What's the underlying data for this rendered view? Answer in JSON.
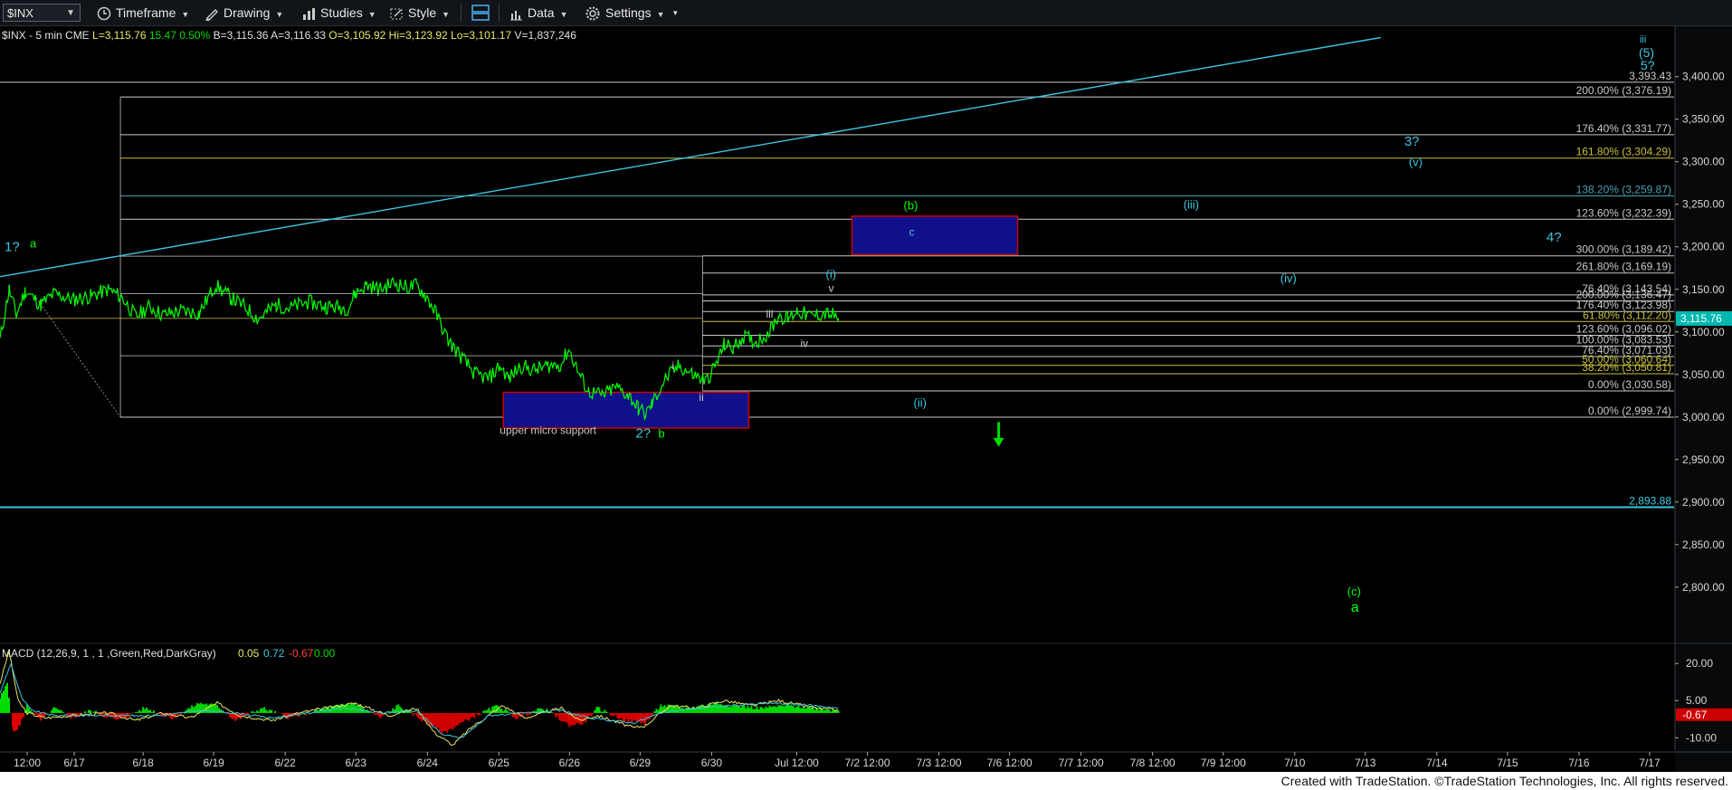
{
  "toolbar": {
    "symbol": "$INX",
    "items": [
      "Timeframe",
      "Drawing",
      "Studies",
      "Style",
      "Data",
      "Settings"
    ]
  },
  "colors": {
    "background": "#000000",
    "price": "#00ff00",
    "wave_cyan": "#3ec6e0",
    "fib_lines": "#c9c9c9",
    "box_fill": "#10108a",
    "box_border": "#cc0000",
    "macd_pos": "#00dd00",
    "macd_neg": "#dd0000",
    "last_price_tag": "#00b8b0"
  },
  "chart_data": {
    "type": "line",
    "header": {
      "symbol": "$INX - 5 min",
      "exchange": "CME",
      "last": "L=3,115.76",
      "change": "15.47",
      "pct": "0.50%",
      "bid": "B=3,115.36",
      "ask": "A=3,116.33",
      "open": "O=3,105.92",
      "high": "Hi=3,123.92",
      "low": "Lo=3,101.17",
      "volume": "V=1,837,246"
    },
    "x_labels": [
      "12:00",
      "6/17",
      "6/18",
      "6/19",
      "6/22",
      "6/23",
      "6/24",
      "6/25",
      "6/26",
      "6/29",
      "6/30",
      "Jul 12:00",
      "7/2 12:00",
      "7/3 12:00",
      "7/6 12:00",
      "7/7 12:00",
      "7/8 12:00",
      "7/9 12:00",
      "7/10",
      "7/13",
      "7/14",
      "7/15",
      "7/16",
      "7/17"
    ],
    "x_label_slots": [
      30,
      82,
      158,
      236,
      315,
      393,
      472,
      551,
      629,
      707,
      786,
      880,
      958,
      1037,
      1115,
      1194,
      1273,
      1351,
      1430,
      1508,
      1587,
      1665,
      1744,
      1822
    ],
    "x_slot_range": [
      0,
      1850
    ],
    "y_ticks": [
      2800,
      2850,
      2900,
      2950,
      3000,
      3050,
      3100,
      3150,
      3200,
      3250,
      3300,
      3350,
      3400
    ],
    "y_tick_labels": [
      "2,800.00",
      "2,850.00",
      "2,900.00",
      "2,950.00",
      "3,000.00",
      "3,050.00",
      "3,100.00",
      "3,150.00",
      "3,200.00",
      "3,250.00",
      "3,300.00",
      "3,350.00",
      "3,400.00"
    ],
    "ylim": [
      2736,
      3455
    ],
    "last_price": 3115.76,
    "last_price_label": "3,115.76",
    "price_keypoints": [
      [
        0,
        3090
      ],
      [
        10,
        3150
      ],
      [
        18,
        3120
      ],
      [
        28,
        3148
      ],
      [
        45,
        3132
      ],
      [
        60,
        3145
      ],
      [
        80,
        3138
      ],
      [
        100,
        3142
      ],
      [
        120,
        3150
      ],
      [
        135,
        3140
      ],
      [
        150,
        3118
      ],
      [
        165,
        3130
      ],
      [
        180,
        3120
      ],
      [
        200,
        3125
      ],
      [
        220,
        3122
      ],
      [
        238,
        3155
      ],
      [
        255,
        3140
      ],
      [
        270,
        3130
      ],
      [
        285,
        3115
      ],
      [
        305,
        3132
      ],
      [
        320,
        3128
      ],
      [
        340,
        3135
      ],
      [
        360,
        3130
      ],
      [
        385,
        3128
      ],
      [
        392,
        3145
      ],
      [
        405,
        3155
      ],
      [
        420,
        3150
      ],
      [
        435,
        3158
      ],
      [
        450,
        3152
      ],
      [
        460,
        3155
      ],
      [
        472,
        3140
      ],
      [
        480,
        3125
      ],
      [
        495,
        3090
      ],
      [
        510,
        3070
      ],
      [
        525,
        3050
      ],
      [
        540,
        3045
      ],
      [
        552,
        3060
      ],
      [
        562,
        3045
      ],
      [
        575,
        3060
      ],
      [
        590,
        3055
      ],
      [
        605,
        3060
      ],
      [
        620,
        3062
      ],
      [
        628,
        3080
      ],
      [
        640,
        3050
      ],
      [
        650,
        3030
      ],
      [
        665,
        3025
      ],
      [
        680,
        3035
      ],
      [
        695,
        3025
      ],
      [
        705,
        3010
      ],
      [
        713,
        3003
      ],
      [
        720,
        3015
      ],
      [
        735,
        3045
      ],
      [
        750,
        3060
      ],
      [
        765,
        3050
      ],
      [
        780,
        3042
      ],
      [
        790,
        3060
      ],
      [
        800,
        3085
      ],
      [
        810,
        3080
      ],
      [
        820,
        3095
      ],
      [
        835,
        3088
      ],
      [
        850,
        3100
      ],
      [
        860,
        3120
      ],
      [
        870,
        3115
      ],
      [
        880,
        3125
      ],
      [
        895,
        3118
      ],
      [
        910,
        3122
      ],
      [
        920,
        3120
      ],
      [
        926,
        3116
      ]
    ],
    "ma_keypoints": [
      [
        0,
        3150
      ],
      [
        40,
        3100
      ]
    ],
    "horizontal_lines": [
      {
        "value": 3393.43,
        "label": "3,393.43",
        "x0": 0,
        "color": "#c9c9c9"
      },
      {
        "value": 3376.19,
        "label": "200.00% (3,376.19)",
        "x0": 133,
        "color": "#c9c9c9"
      },
      {
        "value": 3331.77,
        "label": "176.40% (3,331.77)",
        "x0": 133,
        "color": "#c9c9c9"
      },
      {
        "value": 3304.29,
        "label": "161.80% (3,304.29)",
        "x0": 133,
        "color": "#c8c040"
      },
      {
        "value": 3259.87,
        "label": "138.20% (3,259.87)",
        "x0": 133,
        "color": "#4aa0b0"
      },
      {
        "value": 3232.39,
        "label": "123.60% (3,232.39)",
        "x0": 133,
        "color": "#c9c9c9"
      },
      {
        "value": 3189.42,
        "label": "300.00% (3,189.42)",
        "x0": 776,
        "color": "#c9c9c9"
      },
      {
        "value": 3169.19,
        "label": "261.80% (3,169.19)",
        "x0": 776,
        "color": "#c9c9c9"
      },
      {
        "value": 3143.54,
        "label": "76.40% (3,143.54)",
        "x0": 776,
        "color": "#c9c9c9"
      },
      {
        "value": 3136.47,
        "label": "200.00% (3,136.47)",
        "x0": 776,
        "color": "#c9c9c9"
      },
      {
        "value": 3123.98,
        "label": "176.40% (3,123.98)",
        "x0": 776,
        "color": "#c9c9c9"
      },
      {
        "value": 3112.2,
        "label": "61.80% (3,112.20)",
        "x0": 776,
        "color": "#c8c040"
      },
      {
        "value": 3096.02,
        "label": "123.60% (3,096.02)",
        "x0": 776,
        "color": "#c9c9c9"
      },
      {
        "value": 3083.53,
        "label": "100.00% (3,083.53)",
        "x0": 776,
        "color": "#c9c9c9"
      },
      {
        "value": 3071.03,
        "label": "76.40% (3,071.03)",
        "x0": 776,
        "color": "#c9c9c9"
      },
      {
        "value": 3060.64,
        "label": "50.00% (3,060.64)",
        "x0": 776,
        "color": "#c8c040"
      },
      {
        "value": 3050.81,
        "label": "38.20% (3,050.81)",
        "x0": 776,
        "color": "#c8c040"
      },
      {
        "value": 3030.58,
        "label": "0.00% (3,030.58)",
        "x0": 776,
        "color": "#c9c9c9"
      },
      {
        "value": 2999.74,
        "label": "0.00% (2,999.74)",
        "x0": 133,
        "color": "#c9c9c9"
      },
      {
        "value": 2893.88,
        "label": "2,893.88",
        "x0": 0,
        "color": "#3ec6e0"
      },
      {
        "value": 3145,
        "label": "",
        "x0": 133,
        "x1": 776,
        "color": "#c9c9c9"
      },
      {
        "value": 3072,
        "label": "",
        "x0": 133,
        "x1": 776,
        "color": "#c9c9c9"
      },
      {
        "value": 3189,
        "label": "",
        "x0": 133,
        "x1": 776,
        "color": "#c9c9c9"
      },
      {
        "value": 3116,
        "label": "",
        "x0": 0,
        "x1": 776,
        "color": "#c8c040"
      }
    ],
    "trendline": {
      "p1": [
        0,
        3165
      ],
      "p2": [
        1525,
        3446
      ]
    },
    "zones": [
      {
        "x0": 556,
        "x1": 827,
        "y0": 3029,
        "y1": 2987,
        "label": "upper micro support",
        "label_x": 552,
        "label_y": 2980
      },
      {
        "x0": 941,
        "x1": 1124,
        "y0": 3236,
        "y1": 3191,
        "label": "c",
        "label_x": 1004,
        "label_y": 3213
      }
    ],
    "wave_labels": [
      {
        "text": "1?",
        "x": 5,
        "y": 3195,
        "color": "#3ec6e0",
        "size": 15
      },
      {
        "text": "a",
        "x": 33,
        "y": 3199,
        "color": "#00ff00",
        "size": 13
      },
      {
        "text": "2?",
        "x": 702,
        "y": 2976,
        "color": "#3ec6e0",
        "size": 15
      },
      {
        "text": "b",
        "x": 727,
        "y": 2976,
        "color": "#00ff00",
        "size": 13
      },
      {
        "text": "i",
        "x": 742,
        "y": 3056,
        "color": "#c9c9c9",
        "size": 12
      },
      {
        "text": "ii",
        "x": 772,
        "y": 3019,
        "color": "#c9c9c9",
        "size": 12
      },
      {
        "text": "iii",
        "x": 846,
        "y": 3117,
        "color": "#c9c9c9",
        "size": 12
      },
      {
        "text": "iv",
        "x": 884,
        "y": 3082,
        "color": "#c9c9c9",
        "size": 12
      },
      {
        "text": "v",
        "x": 915,
        "y": 3147,
        "color": "#c9c9c9",
        "size": 12
      },
      {
        "text": "(i)",
        "x": 912,
        "y": 3163,
        "color": "#3ec6e0",
        "size": 13
      },
      {
        "text": "(ii)",
        "x": 1009,
        "y": 3012,
        "color": "#3ec6e0",
        "size": 13
      },
      {
        "text": "(iii)",
        "x": 1307,
        "y": 3245,
        "color": "#3ec6e0",
        "size": 13
      },
      {
        "text": "(iv)",
        "x": 1414,
        "y": 3158,
        "color": "#3ec6e0",
        "size": 13
      },
      {
        "text": "(v)",
        "x": 1556,
        "y": 3295,
        "color": "#3ec6e0",
        "size": 13
      },
      {
        "text": "3?",
        "x": 1551,
        "y": 3319,
        "color": "#3ec6e0",
        "size": 15
      },
      {
        "text": "4?",
        "x": 1708,
        "y": 3206,
        "color": "#3ec6e0",
        "size": 15
      },
      {
        "text": "(b)",
        "x": 998,
        "y": 3244,
        "color": "#00ff00",
        "size": 13
      },
      {
        "text": "(c)",
        "x": 1488,
        "y": 2790,
        "color": "#00ff00",
        "size": 13
      },
      {
        "text": "a",
        "x": 1492,
        "y": 2771,
        "color": "#00ff00",
        "size": 16
      },
      {
        "text": "(5)",
        "x": 1810,
        "y": 3423,
        "color": "#3ec6e0",
        "size": 14
      },
      {
        "text": "5?",
        "x": 1812,
        "y": 3408,
        "color": "#3ec6e0",
        "size": 14
      },
      {
        "text": "iii",
        "x": 1811,
        "y": 3440,
        "color": "#3ec6e0",
        "size": 11
      }
    ],
    "arrow": {
      "x": 1103,
      "y_top": 2994,
      "y_bottom": 2967
    },
    "macd": {
      "label": "MACD (12,26,9, 1 , 1 ,Green,Red,DarkGray)",
      "values": [
        "0.05",
        "0.72",
        "-0.67",
        "0.00"
      ],
      "value_colors": [
        "#e8e86a",
        "#3ec6e0",
        "#ff4040",
        "#00dd00"
      ],
      "y_ticks": [
        20,
        5,
        -10
      ],
      "y_tick_labels": [
        "20.00",
        "5.00",
        "-10.00"
      ],
      "ylim": [
        -15,
        27
      ],
      "last_label": "-0.67",
      "hist_keypoints": [
        [
          0,
          6
        ],
        [
          8,
          12
        ],
        [
          15,
          -8
        ],
        [
          22,
          -5
        ],
        [
          30,
          3
        ],
        [
          45,
          -3
        ],
        [
          60,
          2
        ],
        [
          80,
          -2
        ],
        [
          100,
          1
        ],
        [
          130,
          -3
        ],
        [
          160,
          2
        ],
        [
          190,
          -2
        ],
        [
          220,
          4
        ],
        [
          240,
          3
        ],
        [
          260,
          -3
        ],
        [
          290,
          2
        ],
        [
          320,
          -2
        ],
        [
          360,
          2
        ],
        [
          392,
          4
        ],
        [
          420,
          -2
        ],
        [
          440,
          3
        ],
        [
          472,
          -4
        ],
        [
          490,
          -8
        ],
        [
          500,
          -6
        ],
        [
          520,
          -2
        ],
        [
          550,
          3
        ],
        [
          570,
          -2
        ],
        [
          600,
          2
        ],
        [
          629,
          -5
        ],
        [
          645,
          -4
        ],
        [
          660,
          2
        ],
        [
          690,
          -3
        ],
        [
          713,
          -4
        ],
        [
          730,
          3
        ],
        [
          760,
          2
        ],
        [
          790,
          4
        ],
        [
          810,
          3
        ],
        [
          840,
          2
        ],
        [
          870,
          3
        ],
        [
          900,
          2
        ],
        [
          926,
          1
        ]
      ],
      "macd_keypoints": [
        [
          0,
          12
        ],
        [
          10,
          25
        ],
        [
          20,
          5
        ],
        [
          30,
          0
        ],
        [
          50,
          -2
        ],
        [
          80,
          -1
        ],
        [
          120,
          0
        ],
        [
          150,
          -3
        ],
        [
          180,
          0
        ],
        [
          210,
          -2
        ],
        [
          240,
          4
        ],
        [
          265,
          -1
        ],
        [
          300,
          -3
        ],
        [
          330,
          0
        ],
        [
          360,
          2
        ],
        [
          392,
          4
        ],
        [
          430,
          -1
        ],
        [
          460,
          2
        ],
        [
          480,
          -8
        ],
        [
          500,
          -13
        ],
        [
          520,
          -6
        ],
        [
          555,
          3
        ],
        [
          580,
          -2
        ],
        [
          620,
          2
        ],
        [
          640,
          -3
        ],
        [
          660,
          -1
        ],
        [
          700,
          -6
        ],
        [
          713,
          -5
        ],
        [
          740,
          3
        ],
        [
          770,
          2
        ],
        [
          800,
          5
        ],
        [
          830,
          3
        ],
        [
          860,
          5
        ],
        [
          900,
          2
        ],
        [
          926,
          1
        ]
      ],
      "signal_keypoints": [
        [
          0,
          8
        ],
        [
          12,
          20
        ],
        [
          24,
          6
        ],
        [
          35,
          1
        ],
        [
          60,
          -1
        ],
        [
          100,
          -1
        ],
        [
          140,
          -1
        ],
        [
          180,
          -1
        ],
        [
          220,
          1
        ],
        [
          260,
          0
        ],
        [
          300,
          -2
        ],
        [
          340,
          0
        ],
        [
          380,
          2
        ],
        [
          420,
          0
        ],
        [
          460,
          1
        ],
        [
          490,
          -9
        ],
        [
          510,
          -10
        ],
        [
          540,
          -1
        ],
        [
          580,
          0
        ],
        [
          620,
          1
        ],
        [
          650,
          -2
        ],
        [
          700,
          -4
        ],
        [
          730,
          0
        ],
        [
          770,
          2
        ],
        [
          810,
          3
        ],
        [
          850,
          4
        ],
        [
          900,
          3
        ],
        [
          926,
          2
        ]
      ]
    }
  },
  "footer": {
    "text": "Created with TradeStation. ©TradeStation Technologies, Inc. All rights reserved."
  }
}
